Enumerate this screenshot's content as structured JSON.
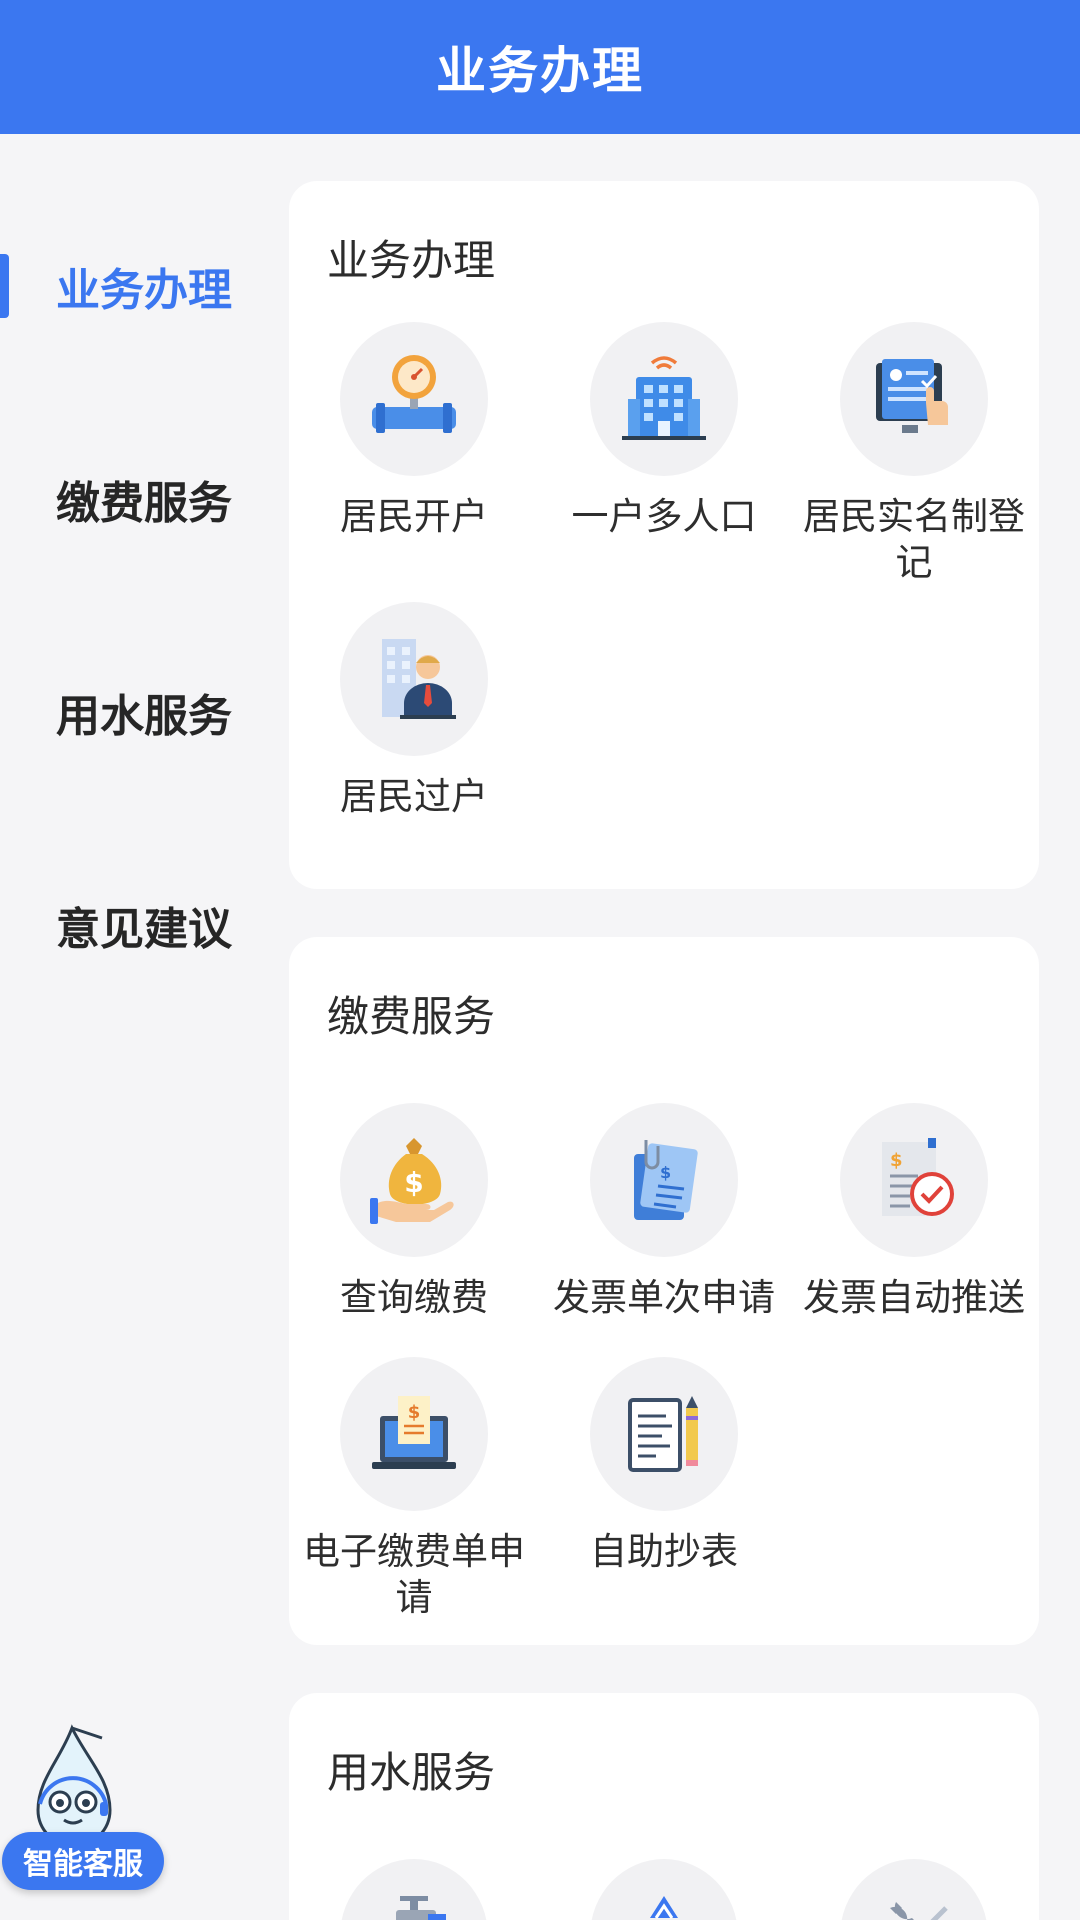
{
  "header": {
    "title": "业务办理"
  },
  "sidebar": {
    "items": [
      {
        "label": "业务办理"
      },
      {
        "label": "缴费服务"
      },
      {
        "label": "用水服务"
      },
      {
        "label": "意见建议"
      }
    ]
  },
  "sections": [
    {
      "title": "业务办理",
      "tiles": [
        {
          "label": "居民开户",
          "icon": "water-meter-icon"
        },
        {
          "label": "一户多人口",
          "icon": "building-icon"
        },
        {
          "label": "居民实名制登记",
          "icon": "id-registration-icon"
        },
        {
          "label": "居民过户",
          "icon": "transfer-person-icon"
        }
      ]
    },
    {
      "title": "缴费服务",
      "tiles": [
        {
          "label": "查询缴费",
          "icon": "money-bag-icon"
        },
        {
          "label": "发票单次申请",
          "icon": "invoice-icon"
        },
        {
          "label": "发票自动推送",
          "icon": "invoice-check-icon"
        },
        {
          "label": "电子缴费单申请",
          "icon": "laptop-bill-icon"
        },
        {
          "label": "自助抄表",
          "icon": "notepad-pencil-icon"
        }
      ]
    },
    {
      "title": "用水服务",
      "tiles": [
        {
          "label": "",
          "icon": "faucet-icon"
        },
        {
          "label": "",
          "icon": "water-drop-icon"
        },
        {
          "label": "",
          "icon": "wrench-icon"
        }
      ]
    }
  ],
  "assistant": {
    "label": "智能客服"
  },
  "colors": {
    "primary": "#3b77f0",
    "background": "#f5f5f7"
  }
}
